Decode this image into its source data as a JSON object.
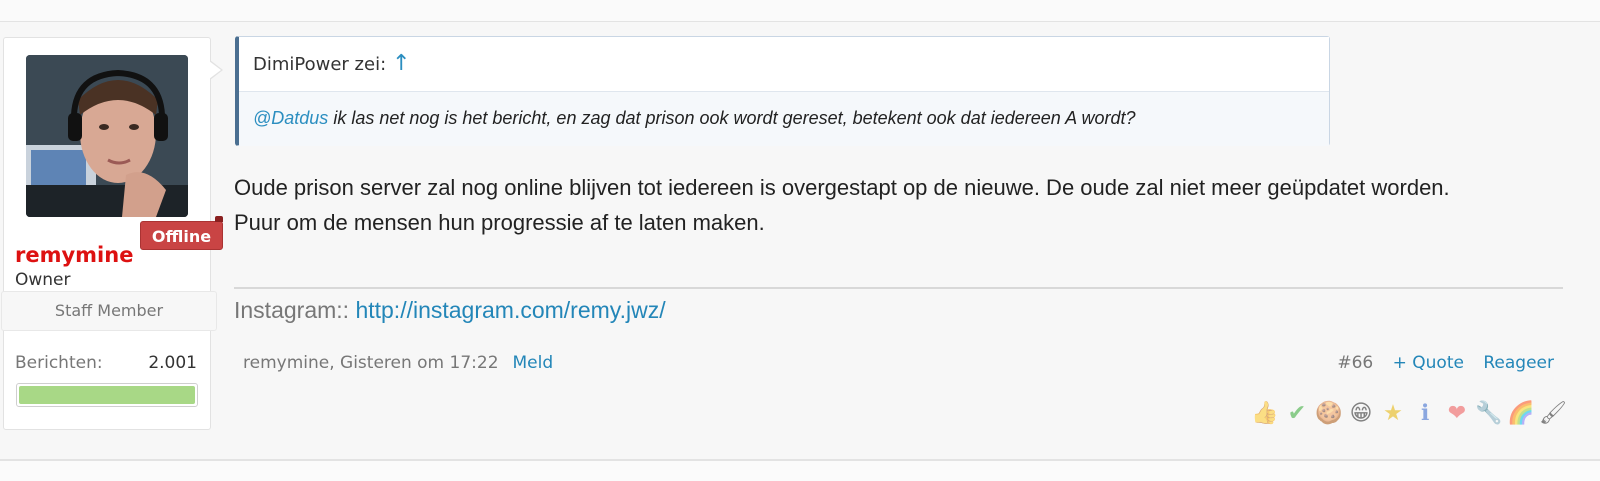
{
  "user": {
    "name": "remymine",
    "title": "Owner",
    "status_badge": "Offline",
    "staff_label": "Staff Member",
    "stats": {
      "posts_label": "Berichten:",
      "posts_value": "2.001"
    }
  },
  "quote": {
    "author_line": "DimiPower zei:",
    "jump_icon": "↑",
    "mention": "@Datdus",
    "text": " ik las net nog is het bericht, en zag dat prison ook wordt gereset, betekent ook dat iedereen A wordt?"
  },
  "message": {
    "line1": "Oude prison server zal nog online blijven tot iedereen is overgestapt op de nieuwe. De oude zal niet meer geüpdatet worden.",
    "line2": "Puur om de mensen hun progressie af te laten maken."
  },
  "signature": {
    "label": "Instagram:: ",
    "link": "http://instagram.com/remy.jwz/"
  },
  "meta": {
    "author_date": "remymine, Gisteren om 17:22",
    "report": "Meld"
  },
  "actions": {
    "post_number": "#66",
    "quote": "+ Quote",
    "reply": "Reageer"
  },
  "reactions": [
    {
      "name": "thumbs-up-icon",
      "glyph": "👍"
    },
    {
      "name": "check-icon",
      "glyph": "✔"
    },
    {
      "name": "cookie-icon",
      "glyph": "🍪"
    },
    {
      "name": "laugh-icon",
      "glyph": "😁"
    },
    {
      "name": "star-medal-icon",
      "glyph": "★"
    },
    {
      "name": "info-icon",
      "glyph": "ℹ"
    },
    {
      "name": "heart-icon",
      "glyph": "❤"
    },
    {
      "name": "wrench-icon",
      "glyph": "🔧"
    },
    {
      "name": "rainbow-icon",
      "glyph": "🌈"
    },
    {
      "name": "brush-icon",
      "glyph": "🖌"
    }
  ],
  "colors": {
    "username": "#dd1111",
    "link": "#2386b8",
    "offline_badge": "#c94444",
    "trophy_fill": "#a8d886"
  }
}
